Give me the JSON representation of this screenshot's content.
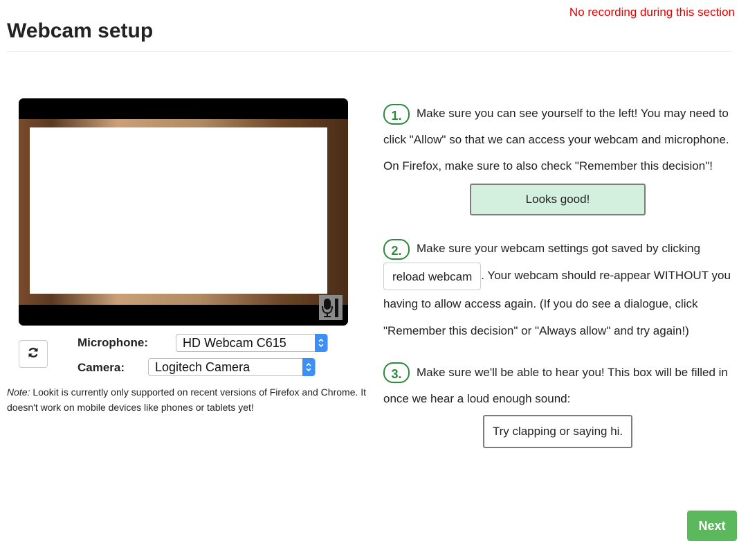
{
  "header": {
    "recording_notice": "No recording during this section",
    "title": "Webcam setup"
  },
  "video": {
    "mic_indicator_icon": "microphone-icon"
  },
  "devices": {
    "refresh_icon": "refresh-icon",
    "microphone_label": "Microphone:",
    "microphone_value": "HD Webcam C615",
    "camera_label": "Camera:",
    "camera_value": "Logitech Camera"
  },
  "note": {
    "prefix": "Note:",
    "text": " Lookit is currently only supported on recent versions of Firefox and Chrome. It doesn't work on mobile devices like phones or tablets yet!"
  },
  "steps": [
    {
      "number": "1.",
      "text": "Make sure you can see yourself to the left! You may need to click \"Allow\" so that we can access your webcam and microphone. On Firefox, make sure to also check \"Remember this decision\"!",
      "button": "Looks good!"
    },
    {
      "number": "2.",
      "text_before": "Make sure your webcam settings got saved by clicking",
      "button": "reload webcam",
      "text_after": ". Your webcam should re-appear WITHOUT you having to allow access again. (If you do see a dialogue, click \"Remember this decision\" or \"Always allow\" and try again!)"
    },
    {
      "number": "3.",
      "text": "Make sure we'll be able to hear you! This box will be filled in once we hear a loud enough sound:",
      "sound_box": "Try clapping or saying hi."
    }
  ],
  "footer": {
    "next_label": "Next"
  },
  "colors": {
    "recording_notice": "#e00000",
    "step_badge": "#2c8a3c",
    "looks_good_bg": "#d3efdd",
    "next_button": "#5cb85c",
    "select_chevron": "#3b8ff6"
  }
}
